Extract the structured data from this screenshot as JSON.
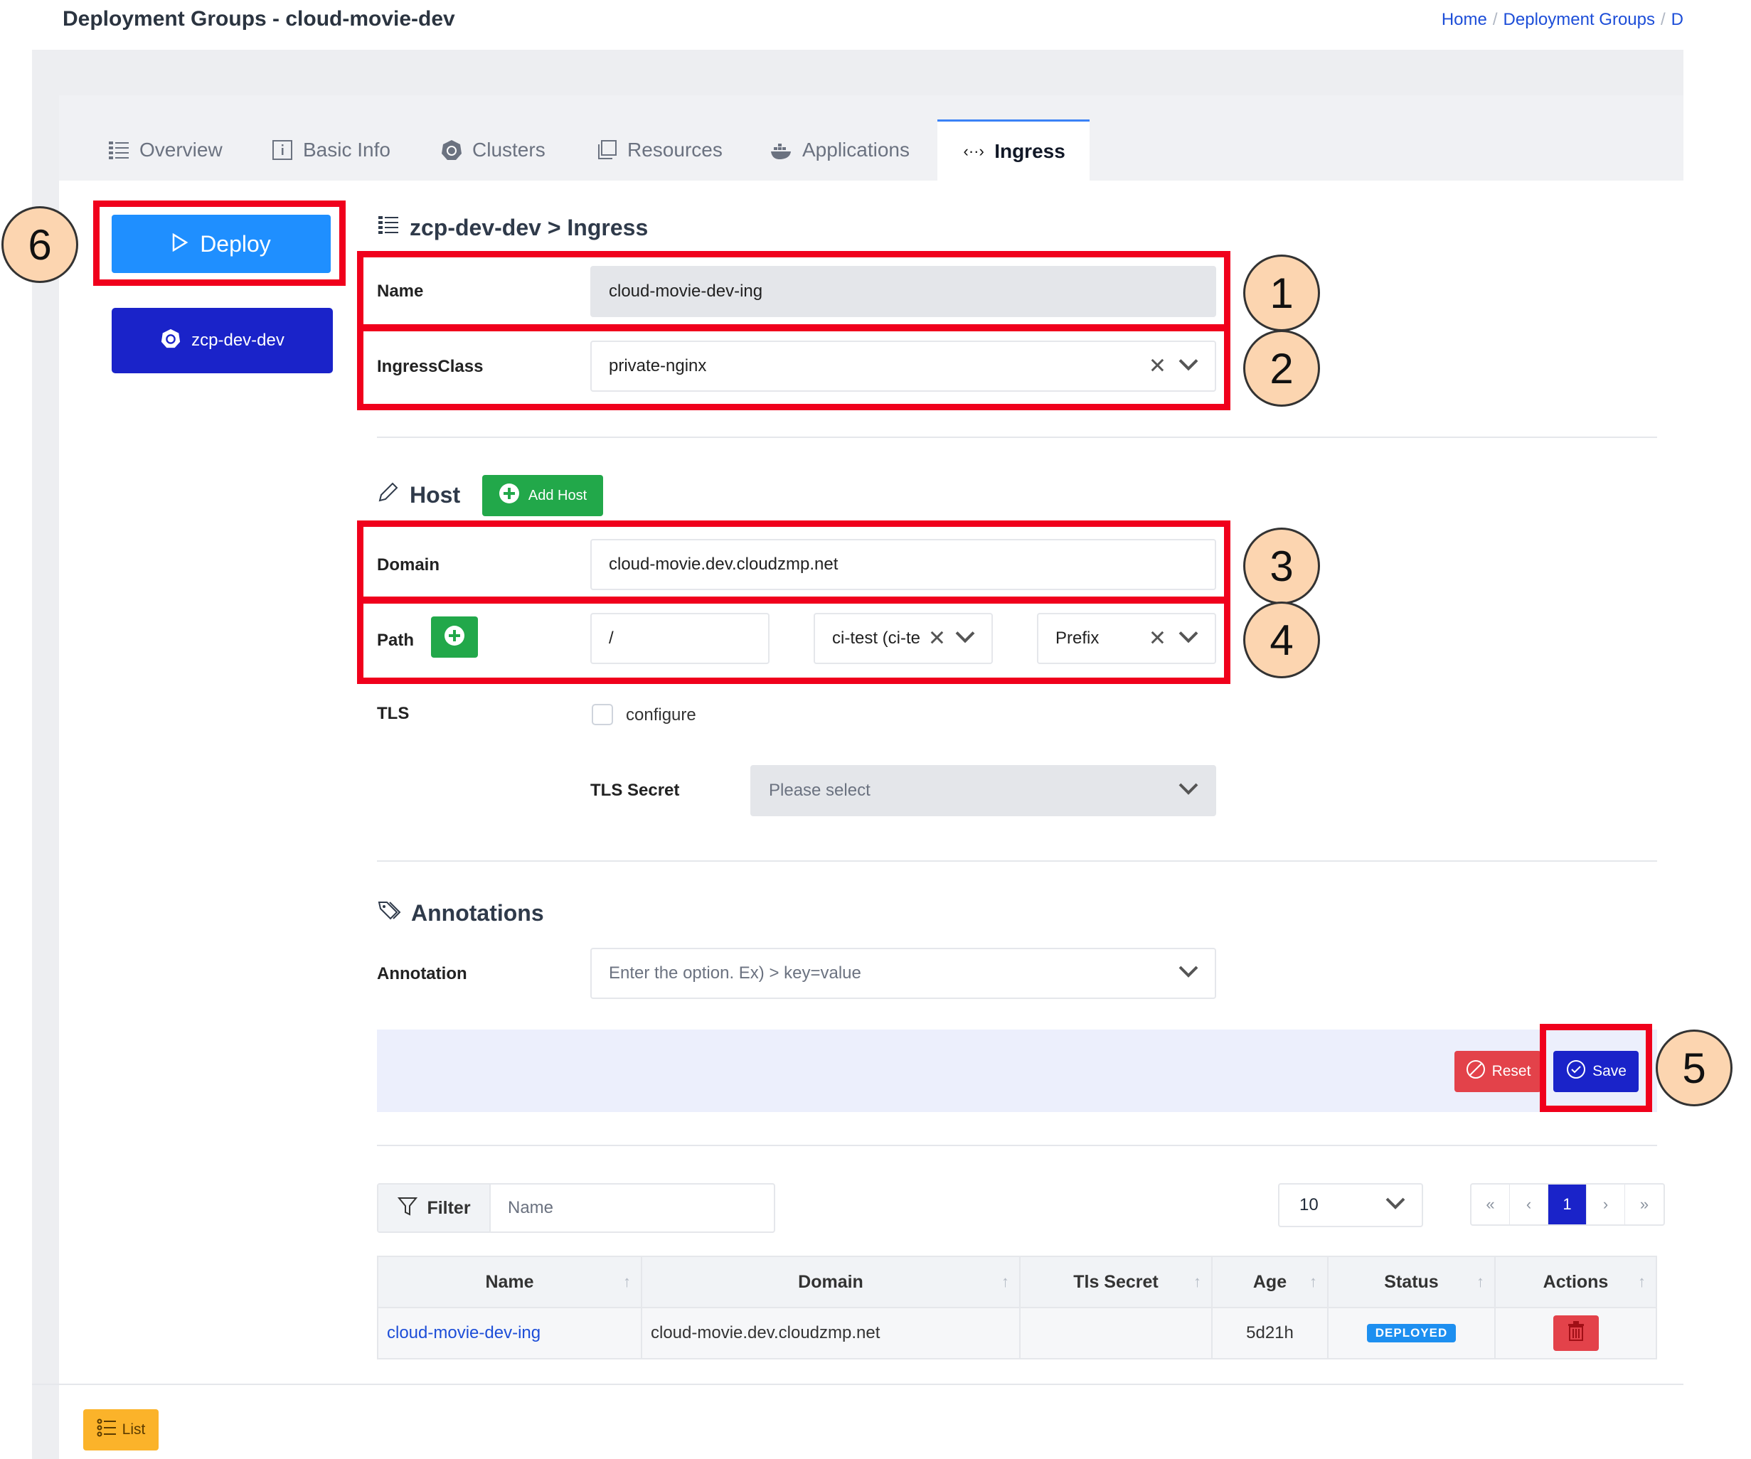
{
  "header": {
    "title": "Deployment Groups - cloud-movie-dev",
    "breadcrumb": [
      "Home",
      "Deployment Groups",
      "D"
    ]
  },
  "tabs": [
    {
      "label": "Overview",
      "icon": "list-icon"
    },
    {
      "label": "Basic Info",
      "icon": "info-icon"
    },
    {
      "label": "Clusters",
      "icon": "kubernetes-icon"
    },
    {
      "label": "Resources",
      "icon": "copy-icon"
    },
    {
      "label": "Applications",
      "icon": "docker-icon"
    },
    {
      "label": "Ingress",
      "icon": "code-icon",
      "active": true
    }
  ],
  "sidebar": {
    "deploy_label": "Deploy",
    "cluster_label": "zcp-dev-dev"
  },
  "callouts": [
    "1",
    "2",
    "3",
    "4",
    "5",
    "6"
  ],
  "form": {
    "heading": "zcp-dev-dev > Ingress",
    "name_label": "Name",
    "name_value": "cloud-movie-dev-ing",
    "ingress_class_label": "IngressClass",
    "ingress_class_value": "private-nginx"
  },
  "host": {
    "heading": "Host",
    "add_host_label": "Add Host",
    "domain_label": "Domain",
    "domain_value": "cloud-movie.dev.cloudzmp.net",
    "path_label": "Path",
    "path_value": "/",
    "service_value": "ci-test (ci-te",
    "path_type_value": "Prefix",
    "tls_label": "TLS",
    "tls_checkbox_label": "configure",
    "tls_secret_label": "TLS Secret",
    "tls_secret_placeholder": "Please select"
  },
  "annotations": {
    "heading": "Annotations",
    "label": "Annotation",
    "placeholder": "Enter the option. Ex) > key=value"
  },
  "actions": {
    "reset_label": "Reset",
    "save_label": "Save"
  },
  "list_controls": {
    "filter_label": "Filter",
    "filter_placeholder": "Name",
    "page_size": "10",
    "pager": [
      "«",
      "‹",
      "1",
      "›",
      "»"
    ]
  },
  "table": {
    "columns": [
      "Name",
      "Domain",
      "Tls Secret",
      "Age",
      "Status",
      "Actions"
    ],
    "rows": [
      {
        "name": "cloud-movie-dev-ing",
        "domain": "cloud-movie.dev.cloudzmp.net",
        "tls_secret": "",
        "age": "5d21h",
        "status": "DEPLOYED"
      }
    ]
  },
  "footer": {
    "list_label": "List"
  },
  "colors": {
    "accent": "#1a23c9",
    "deploy": "#1f8fff",
    "success": "#22a84a",
    "danger": "#e3424a",
    "highlight": "#f0001c",
    "callout": "#fcd5b0",
    "warning": "#fbb32a"
  }
}
